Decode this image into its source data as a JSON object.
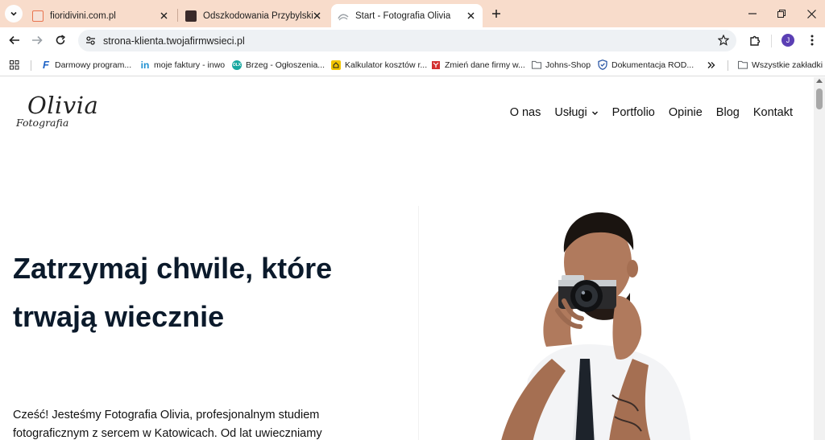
{
  "browser": {
    "tabs": [
      {
        "title": "fioridivini.com.pl",
        "active": false,
        "favicon_color": "#e8744f"
      },
      {
        "title": "Odszkodowania Przybylski Piotr",
        "active": false,
        "favicon_color": "#3a2a2a"
      },
      {
        "title": "Start - Fotografia Olivia",
        "active": true,
        "favicon_color": "#9aa0a6"
      }
    ],
    "address_bar": {
      "url": "strona-klienta.twojafirmwsieci.pl"
    },
    "profile_initial": "J",
    "bookmarks": [
      {
        "label": "Darmowy program...",
        "icon": "f-logo-icon",
        "color": "#1e63c6"
      },
      {
        "label": "moje faktury - inwo",
        "icon": "in-logo-icon",
        "color": "#1d8fd1"
      },
      {
        "label": "Brzeg - Ogłoszenia...",
        "icon": "olx-logo-icon",
        "color": "#17a8a0"
      },
      {
        "label": "Kalkulator kosztów r...",
        "icon": "calculator-icon",
        "color": "#f2c400"
      },
      {
        "label": "Zmień dane firmy w...",
        "icon": "emblem-icon",
        "color": "#d32f2f"
      },
      {
        "label": "Johns-Shop",
        "icon": "folder-icon",
        "color": "#5f6368"
      },
      {
        "label": "Dokumentacja ROD...",
        "icon": "shield-icon",
        "color": "#2b57a6"
      }
    ],
    "all_bookmarks_label": "Wszystkie zakładki"
  },
  "site": {
    "logo": {
      "name": "Olivia",
      "tagline": "Fotografia"
    },
    "nav": [
      {
        "label": "O nas"
      },
      {
        "label": "Usługi",
        "has_dropdown": true
      },
      {
        "label": "Portfolio"
      },
      {
        "label": "Opinie"
      },
      {
        "label": "Blog"
      },
      {
        "label": "Kontakt"
      }
    ],
    "hero": {
      "title_line1": "Zatrzymaj chwile, które",
      "title_line2": "trwają wiecznie",
      "text_line1": "Cześć! Jesteśmy Fotografia Olivia, profesjonalnym studiem",
      "text_line2": "fotograficznym z sercem w Katowicach. Od lat uwieczniamy"
    }
  }
}
